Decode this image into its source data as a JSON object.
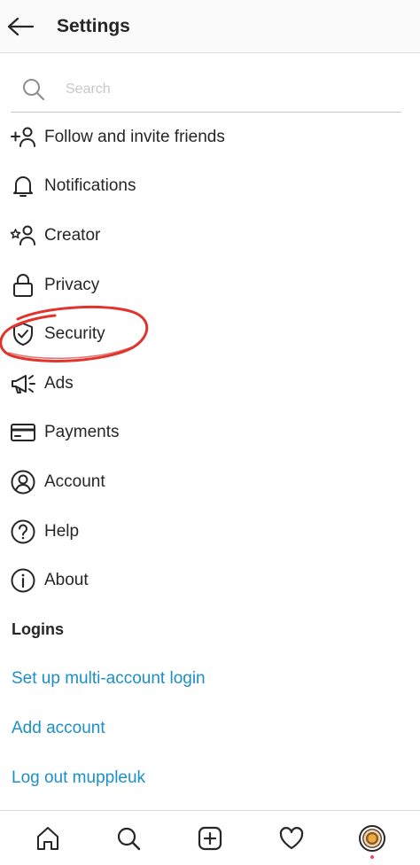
{
  "header": {
    "title": "Settings"
  },
  "search": {
    "placeholder": "Search"
  },
  "menu": [
    {
      "label": "Follow and invite friends",
      "icon": "add-person-icon"
    },
    {
      "label": "Notifications",
      "icon": "bell-icon"
    },
    {
      "label": "Creator",
      "icon": "star-person-icon"
    },
    {
      "label": "Privacy",
      "icon": "lock-icon"
    },
    {
      "label": "Security",
      "icon": "shield-check-icon"
    },
    {
      "label": "Ads",
      "icon": "megaphone-icon"
    },
    {
      "label": "Payments",
      "icon": "credit-card-icon"
    },
    {
      "label": "Account",
      "icon": "person-circle-icon"
    },
    {
      "label": "Help",
      "icon": "question-circle-icon"
    },
    {
      "label": "About",
      "icon": "info-circle-icon"
    }
  ],
  "logins": {
    "title": "Logins",
    "links": [
      "Set up multi-account login",
      "Add account",
      "Log out muppleuk"
    ]
  },
  "bottom_nav": [
    "home-icon",
    "search-icon",
    "new-post-icon",
    "heart-icon",
    "profile-avatar"
  ],
  "colors": {
    "link": "#1b8fc7",
    "annotation": "#e0342c",
    "text": "#262626"
  }
}
